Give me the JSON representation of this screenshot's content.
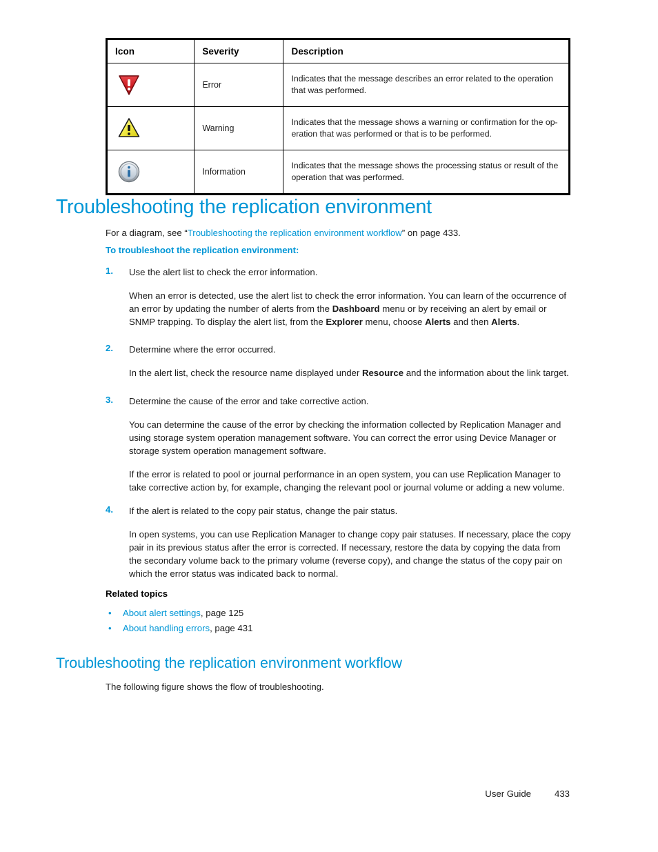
{
  "legend_table": {
    "headers": [
      "Icon",
      "Severity",
      "Description"
    ],
    "rows": [
      {
        "icon": "error-triangle-icon",
        "severity": "Error",
        "description": "Indicates that the message describes an error related to the operation that was performed."
      },
      {
        "icon": "warning-triangle-icon",
        "severity": "Warning",
        "description": "Indicates that the message shows a warning or confirmation for the op-eration that was performed or that is to be performed."
      },
      {
        "icon": "information-circle-icon",
        "severity": "Information",
        "description": "Indicates that the message shows the processing status or result of the operation that was performed."
      }
    ]
  },
  "section1": {
    "heading": "Troubleshooting the replication environment",
    "intro_prefix": "For a diagram, see “",
    "intro_link": "Troubleshooting the replication environment workflow",
    "intro_suffix": "” on page 433.",
    "procedure_heading": "To troubleshoot the replication environment:",
    "steps": [
      {
        "num": "1.",
        "title": "Use the alert list to check the error information.",
        "body_1": "When an error is detected, use the alert list to check the error information. You can learn of the occurrence of an error by updating the number of alerts from the ",
        "bold_1": "Dashboard",
        "body_2": " menu or by receiving an alert by email or SNMP trapping. To display the alert list, from the ",
        "bold_2": "Explorer",
        "body_3": " menu, choose ",
        "bold_3": "Alerts",
        "body_4": " and then ",
        "bold_4": "Alerts",
        "body_5": "."
      },
      {
        "num": "2.",
        "title": "Determine where the error occurred.",
        "body_1": "In the alert list, check the resource name displayed under ",
        "bold_1": "Resource",
        "body_2": " and the information about the link target."
      },
      {
        "num": "3.",
        "title": "Determine the cause of the error and take corrective action.",
        "body_1": "You can determine the cause of the error by checking the information collected by Replication Manager and using storage system operation management software. You can correct the error using Device Manager or storage system operation management software.",
        "body_2": "If the error is related to pool or journal performance in an open system, you can use Replication Manager to take corrective action by, for example, changing the relevant pool or journal volume or adding a new volume."
      },
      {
        "num": "4.",
        "title": "If the alert is related to the copy pair status, change the pair status.",
        "body_1": "In open systems, you can use Replication Manager to change copy pair statuses. If necessary, place the copy pair in its previous status after the error is corrected. If necessary, restore the data by copying the data from the secondary volume back to the primary volume (reverse copy), and change the status of the copy pair on which the error status was indicated back to normal."
      }
    ],
    "related_heading": "Related topics",
    "related": [
      {
        "bullet": "•",
        "link": "About alert settings",
        "suffix": ", page 125"
      },
      {
        "bullet": "•",
        "link": "About handling errors",
        "suffix": ", page 431"
      }
    ]
  },
  "section2": {
    "heading": "Troubleshooting the replication environment workflow",
    "body": "The following figure shows the flow of troubleshooting."
  },
  "footer": {
    "label": "User Guide",
    "page": "433"
  },
  "colors": {
    "accent_blue": "#0096d6",
    "text": "#1a1a1a",
    "error_red": "#cf1f25",
    "warning_yellow": "#f2ea30",
    "info_blue": "#2c6ea5"
  }
}
